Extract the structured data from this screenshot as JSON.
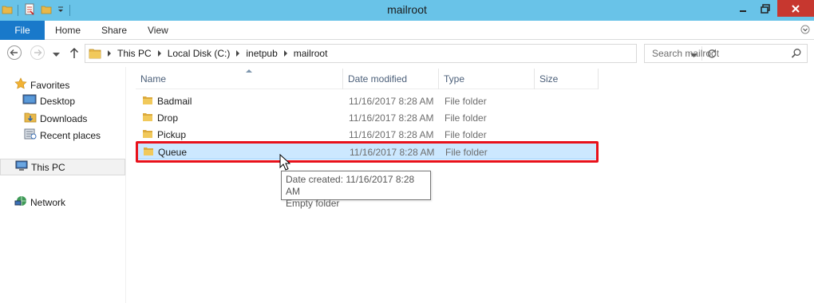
{
  "window": {
    "title": "mailroot",
    "controls": {
      "minimize": "minimize",
      "maximize": "restore",
      "close": "close"
    }
  },
  "ribbon": {
    "tabs": [
      "File",
      "Home",
      "Share",
      "View"
    ]
  },
  "address": {
    "crumbs": [
      "This PC",
      "Local Disk (C:)",
      "inetpub",
      "mailroot"
    ]
  },
  "search": {
    "placeholder": "Search mailroot"
  },
  "navpane": {
    "favorites": "Favorites",
    "favorites_items": [
      "Desktop",
      "Downloads",
      "Recent places"
    ],
    "this_pc": "This PC",
    "network": "Network"
  },
  "columns": [
    "Name",
    "Date modified",
    "Type",
    "Size"
  ],
  "files": [
    {
      "name": "Badmail",
      "date": "11/16/2017 8:28 AM",
      "type": "File folder"
    },
    {
      "name": "Drop",
      "date": "11/16/2017 8:28 AM",
      "type": "File folder"
    },
    {
      "name": "Pickup",
      "date": "11/16/2017 8:28 AM",
      "type": "File folder"
    },
    {
      "name": "Queue",
      "date": "11/16/2017 8:28 AM",
      "type": "File folder",
      "selected": true
    }
  ],
  "tooltip": {
    "line1": "Date created: 11/16/2017 8:28 AM",
    "line2": "Empty folder"
  },
  "colors": {
    "titlebar": "#69c3e8",
    "file_tab": "#1979ca",
    "close": "#c7372f",
    "selection": "#cce8ff",
    "highlight": "#e8111b",
    "folder": "#e8b84a"
  }
}
